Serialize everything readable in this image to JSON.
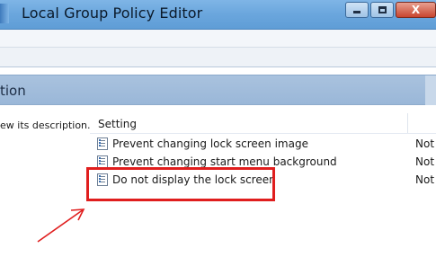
{
  "window": {
    "title": "Local Group Policy Editor",
    "controls": {
      "minimize": "",
      "maximize": "",
      "close": "X"
    }
  },
  "section": {
    "title_fragment": "tion"
  },
  "description_pane": {
    "text_fragment": "ew its description."
  },
  "list": {
    "columns": {
      "setting": "Setting"
    },
    "rows": [
      {
        "label": "Prevent changing lock screen image",
        "state": "Not"
      },
      {
        "label": "Prevent changing start menu background",
        "state": "Not"
      },
      {
        "label": "Do not display the lock screen",
        "state": "Not"
      }
    ]
  },
  "colors": {
    "titlebar": "#6aa6dd",
    "section_header": "#9ab7d8",
    "highlight": "#e01e1e",
    "close_button": "#c8452f"
  },
  "icons": {
    "policy": "policy-setting-icon",
    "app": "group-policy-app-icon",
    "annotation": "red-arrow-annotation"
  }
}
